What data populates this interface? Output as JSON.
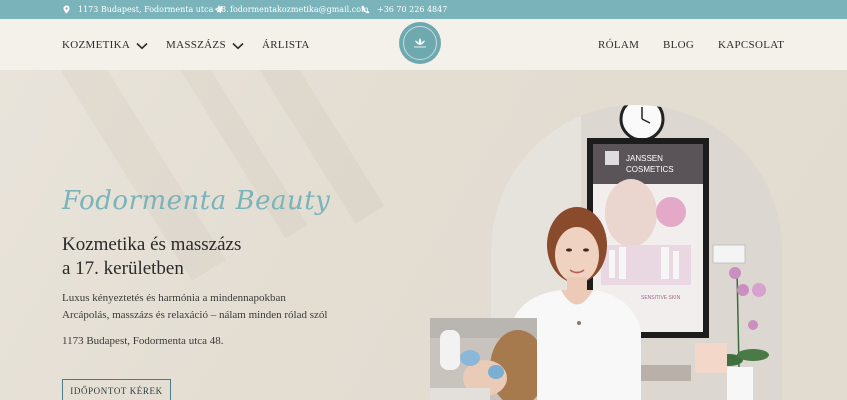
{
  "topbar": {
    "address": "1173 Budapest, Fodormenta utca 48.",
    "email": "fodormentakozmetika@gmail.com",
    "phone": "+36 70 226 4847"
  },
  "nav": {
    "left": [
      {
        "label": "KOZMETIKA",
        "dropdown": true
      },
      {
        "label": "MASSZÁZS",
        "dropdown": true
      },
      {
        "label": "ÁRLISTA",
        "dropdown": false
      }
    ],
    "right": [
      {
        "label": "RÓLAM"
      },
      {
        "label": "BLOG"
      },
      {
        "label": "KAPCSOLAT"
      }
    ]
  },
  "hero": {
    "brand": "Fodormenta Beauty",
    "headline_line1": "Kozmetika és masszázs",
    "headline_line2": "a 17. kerületben",
    "tagline1": "Luxus kényeztetés és harmónia a mindennapokban",
    "tagline2": "Arcápolás, masszázs és relaxáció – nálam minden rólad szól",
    "address": "1173 Budapest, Fodormenta utca 48.",
    "cta_label": "IDŐPONTOT KÉREK"
  },
  "photo": {
    "poster_brand_line1": "JANSSEN",
    "poster_brand_line2": "COSMETICS",
    "poster_caption": "SENSITIVE SKIN"
  },
  "colors": {
    "accent": "#7bb3bb",
    "header_bg": "#f4f0ea",
    "hero_bg": "#e6e0d6",
    "button_border": "#4a7d85"
  },
  "icons": [
    "location-pin-icon",
    "send-icon",
    "email-icon",
    "phone-icon",
    "chevron-down-icon",
    "logo-flower-icon"
  ]
}
